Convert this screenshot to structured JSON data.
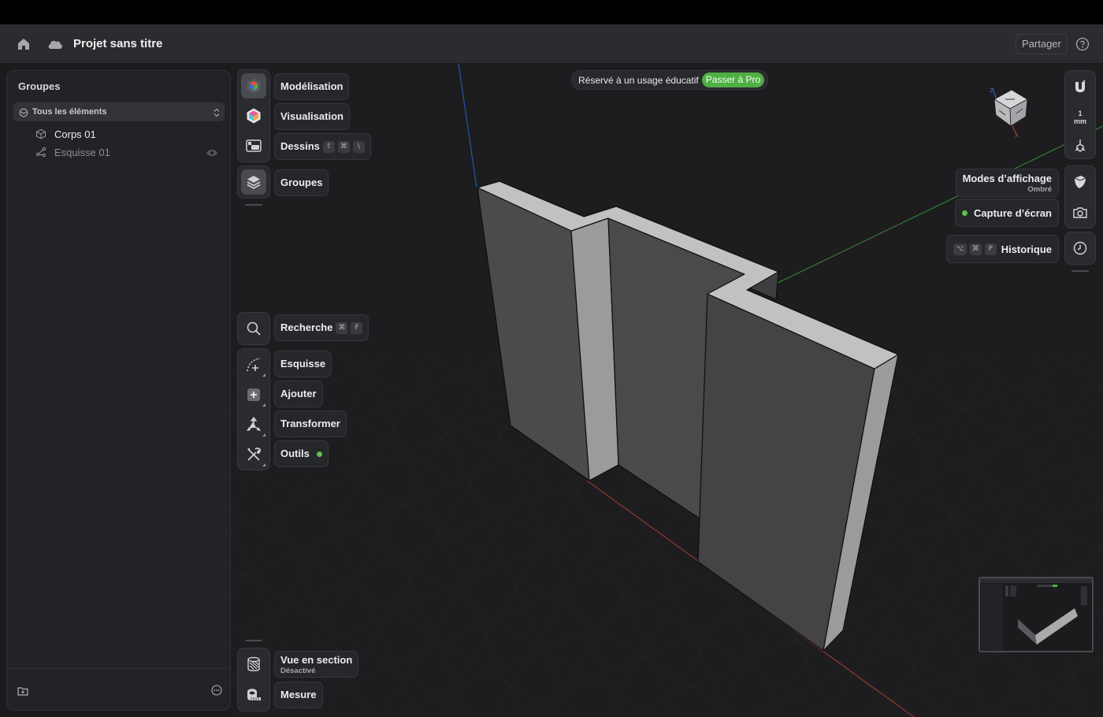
{
  "titlebar": {
    "project_title": "Projet sans titre",
    "share_label": "Partager"
  },
  "banner": {
    "text": "Réservé à un usage éducatif",
    "cta": "Passer à Pro"
  },
  "sidebar": {
    "header": "Groupes",
    "filter": "Tous les éléments",
    "items": [
      {
        "label": "Corps 01",
        "icon": "body-cube-icon"
      },
      {
        "label": "Esquisse 01",
        "icon": "sketch-icon"
      }
    ]
  },
  "left_tools": {
    "modeling": "Modélisation",
    "visualization": "Visualisation",
    "drawings": "Dessins",
    "drawings_keys": [
      "⇧",
      "⌘",
      "\\"
    ],
    "groups": "Groupes",
    "search": "Recherche",
    "search_keys": [
      "⌘",
      "F"
    ],
    "sketch": "Esquisse",
    "add": "Ajouter",
    "transform": "Transformer",
    "tools": "Outils",
    "section_view": "Vue en section",
    "section_view_state": "Désactivé",
    "measure": "Mesure"
  },
  "right_tools": {
    "unit_value": "1",
    "unit": "mm",
    "display_modes": "Modes d’affichage",
    "display_mode_value": "Ombré",
    "screenshot": "Capture d’écran",
    "history": "Historique",
    "history_keys": [
      "⌥",
      "⌘",
      "P"
    ]
  },
  "colors": {
    "accent_green": "#4fae44",
    "status_dot": "#5bc24a",
    "axis_x": "#b33a32",
    "axis_y": "#3c8a3a",
    "axis_z": "#2a5fbf"
  }
}
